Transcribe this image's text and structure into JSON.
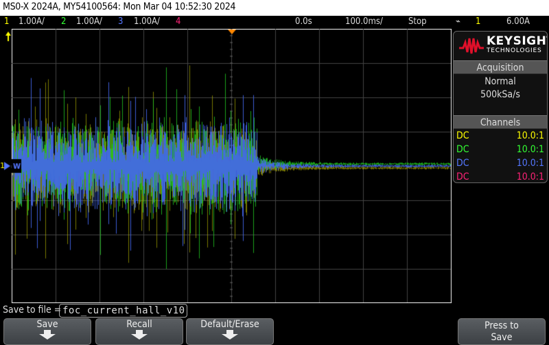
{
  "title": "MS0-X 2024A, MY54100564: Mon Mar 04 10:52:30 2024",
  "channels": [
    {
      "num": "1",
      "scale": "1.00A/",
      "color": "#ffff00"
    },
    {
      "num": "2",
      "scale": "1.00A/",
      "color": "#33ff33"
    },
    {
      "num": "3",
      "scale": "1.00A/",
      "color": "#5577ff"
    },
    {
      "num": "4",
      "scale": "",
      "color": "#ff2277"
    }
  ],
  "timebase": {
    "delay": "0.0s",
    "scale": "100.0ms/",
    "run_state": "Stop"
  },
  "trigger": {
    "source": "1",
    "level": "6.00A"
  },
  "brand": {
    "name": "KEYSIGHT",
    "sub": "TECHNOLOGIES"
  },
  "acquisition": {
    "header": "Acquisition",
    "mode": "Normal",
    "rate": "500kSa/s"
  },
  "channels_panel": {
    "header": "Channels",
    "rows": [
      {
        "coupling": "DC",
        "probe": "10.0:1",
        "color": "#ffff00"
      },
      {
        "coupling": "DC",
        "probe": "10.0:1",
        "color": "#33ff33"
      },
      {
        "coupling": "DC",
        "probe": "10.0:1",
        "color": "#5577ff"
      },
      {
        "coupling": "DC",
        "probe": "10.0:1",
        "color": "#ff2277"
      }
    ]
  },
  "save": {
    "label": "Save to file =",
    "filename": "foc_current_hall_v10"
  },
  "softkeys": [
    "Save",
    "Recall",
    "Default/Erase",
    "Press to Save"
  ]
}
